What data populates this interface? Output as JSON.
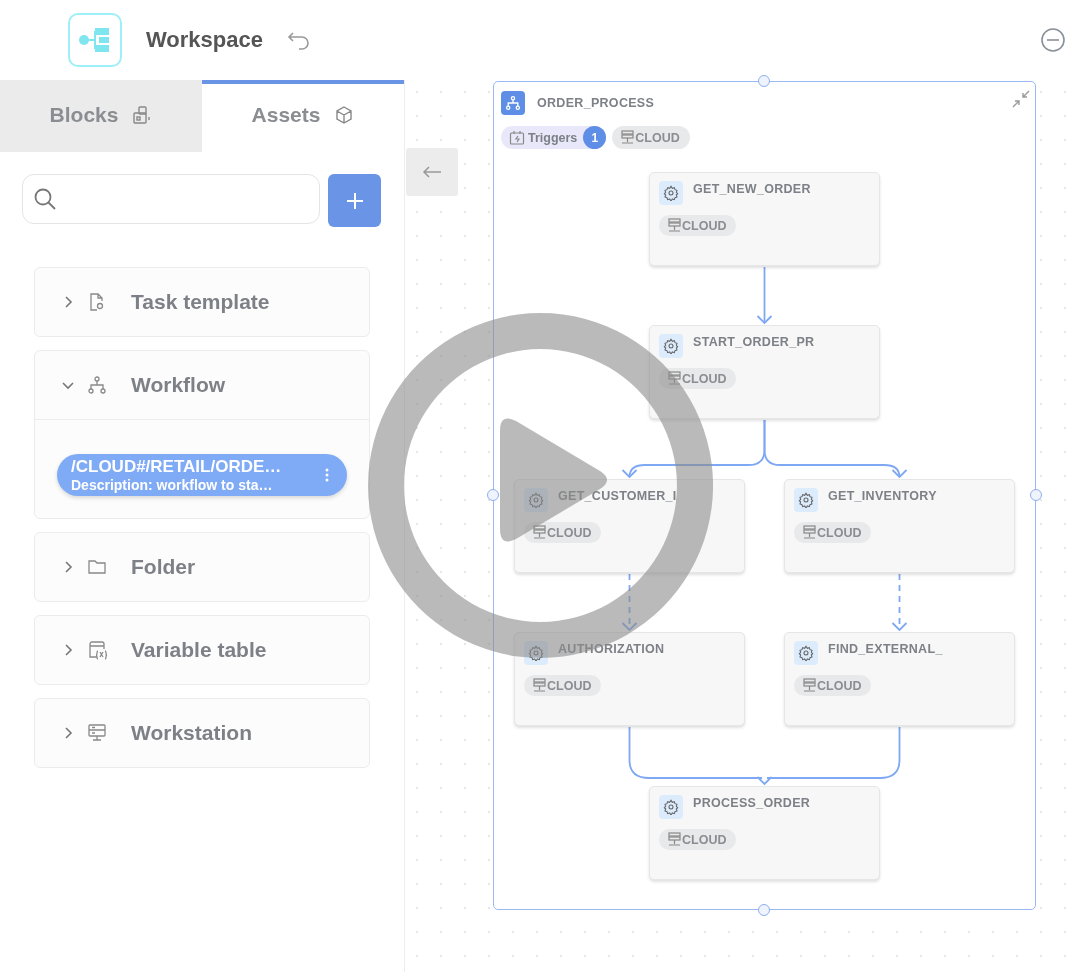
{
  "header": {
    "title": "Workspace"
  },
  "tabs": [
    {
      "label": "Blocks",
      "kind": "blocks",
      "selected": false
    },
    {
      "label": "Assets",
      "kind": "assets",
      "selected": true
    }
  ],
  "sections": [
    {
      "label": "Task template",
      "kind": "task",
      "expanded": false
    },
    {
      "label": "Workflow",
      "kind": "workflow",
      "expanded": true,
      "items": [
        {
          "path": "/CLOUD#/RETAIL/ORDE…",
          "description": "Description: workflow to sta…"
        }
      ]
    },
    {
      "label": "Folder",
      "kind": "folder",
      "expanded": false
    },
    {
      "label": "Variable table",
      "kind": "variable",
      "expanded": false
    },
    {
      "label": "Workstation",
      "kind": "workstation",
      "expanded": false
    }
  ],
  "canvas": {
    "group": {
      "title": "ORDER_PROCESS",
      "triggers_label": "Triggers",
      "triggers_count": "1",
      "tag": "CLOUD"
    },
    "nodes": [
      {
        "title": "GET_NEW_ORDER",
        "tag": "CLOUD"
      },
      {
        "title": "START_ORDER_PR",
        "tag": "CLOUD"
      },
      {
        "title": "GET_CUSTOMER_I",
        "tag": "CLOUD"
      },
      {
        "title": "GET_INVENTORY",
        "tag": "CLOUD"
      },
      {
        "title": "AUTHORIZATION",
        "tag": "CLOUD"
      },
      {
        "title": "FIND_EXTERNAL_",
        "tag": "CLOUD"
      },
      {
        "title": "PROCESS_ORDER",
        "tag": "CLOUD"
      }
    ],
    "edges": [
      {
        "kind": "solid"
      },
      {
        "kind": "solid"
      },
      {
        "kind": "solid"
      },
      {
        "kind": "dashed"
      },
      {
        "kind": "dashed"
      },
      {
        "kind": "solid"
      },
      {
        "kind": "solid"
      }
    ]
  }
}
